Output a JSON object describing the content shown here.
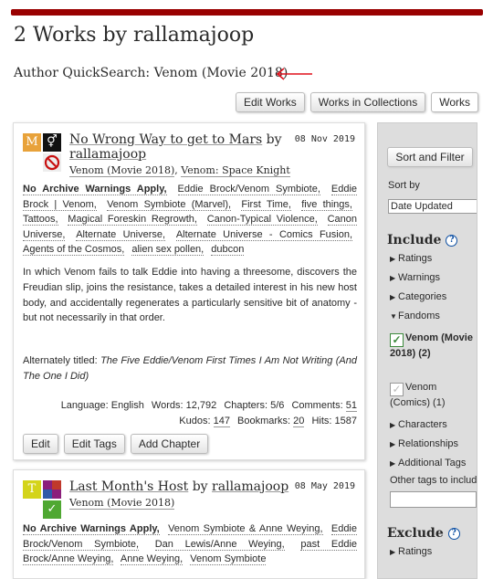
{
  "heading": "2 Works by rallamajoop",
  "quicksearch": "Author QuickSearch: Venom (Movie 2018)",
  "nav_buttons": [
    "Edit Works",
    "Works in Collections",
    "Works"
  ],
  "colors": {
    "brand": "#990000",
    "annotation_arrow": "#e0101c",
    "link_blue": "#0b4ea2"
  },
  "works": [
    {
      "title": "No Wrong Way to get to Mars",
      "by": "by",
      "author": "rallamajoop",
      "date": "08 Nov 2019",
      "required_tags": [
        "M",
        "⚥",
        "",
        "⊘"
      ],
      "fandoms": [
        "Venom (Movie 2018)",
        "Venom: Space Knight"
      ],
      "warning": "No Archive Warnings Apply,",
      "tags": [
        "Eddie Brock/Venom Symbiote,",
        "Eddie Brock | Venom,",
        "Venom Symbiote (Marvel),",
        "First Time,",
        "five things,",
        "Tattoos,",
        "Magical Foreskin Regrowth,",
        "Canon-Typical Violence,",
        "Canon Universe,",
        "Alternate Universe,",
        "Alternate Universe - Comics Fusion,",
        "Agents of the Cosmos,",
        "alien sex pollen,",
        "dubcon"
      ],
      "summary": "In which Venom fails to talk Eddie into having a threesome, discovers the Freudian slip, joins the resistance, takes a detailed interest in his new host body, and accidentally regenerates a particularly sensitive bit of anatomy - but not necessarily in that order.",
      "alt_prefix": "Alternately titled:",
      "alt_title": "The Five Eddie/Venom First Times I Am Not Writing (And The One I Did)",
      "stats": {
        "language_label": "Language:",
        "language": "English",
        "words_label": "Words:",
        "words": "12,792",
        "chapters_label": "Chapters:",
        "chapters": "5/6",
        "comments_label": "Comments:",
        "comments": "51",
        "kudos_label": "Kudos:",
        "kudos": "147",
        "bookmarks_label": "Bookmarks:",
        "bookmarks": "20",
        "hits_label": "Hits:",
        "hits": "1587"
      },
      "buttons": [
        "Edit",
        "Edit Tags",
        "Add Chapter"
      ]
    },
    {
      "title": "Last Month's Host",
      "by": "by",
      "author": "rallamajoop",
      "date": "08 May 2019",
      "required_tags": [
        "T",
        "",
        "",
        "✓"
      ],
      "fandoms": [
        "Venom (Movie 2018)"
      ],
      "warning": "No Archive Warnings Apply,",
      "tags": [
        "Venom Symbiote & Anne Weying,",
        "Eddie Brock/Venom Symbiote,",
        "Dan Lewis/Anne Weying,",
        "past Eddie Brock/Anne Weying,",
        "Anne Weying,",
        "Venom Symbiote"
      ]
    }
  ],
  "sidebar": {
    "sort_filter": "Sort and Filter",
    "sort_by": "Sort by",
    "sort_value": "Date Updated",
    "include": "Include",
    "include_items": [
      "Ratings",
      "Warnings",
      "Categories"
    ],
    "fandoms_label": "Fandoms",
    "fandom_options": [
      {
        "label": "Venom (Movie 2018) (2)",
        "checked": true
      },
      {
        "label": "Venom (Comics) (1)",
        "checked": false
      }
    ],
    "include_items2": [
      "Characters",
      "Relationships",
      "Additional Tags"
    ],
    "other_tags": "Other tags to include",
    "exclude": "Exclude",
    "exclude_items": [
      "Ratings"
    ],
    "help_glyph": "?"
  }
}
